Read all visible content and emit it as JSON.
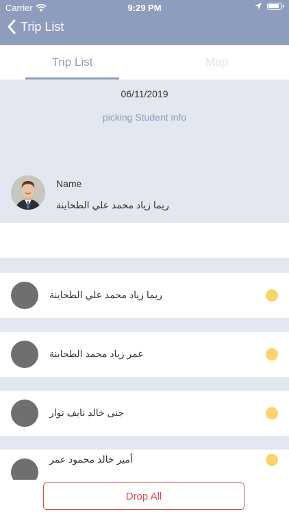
{
  "status_bar": {
    "carrier": "Carrier",
    "time": "9:29 PM"
  },
  "nav": {
    "back_label": "Trip List"
  },
  "tabs": {
    "items": [
      {
        "label": "Trip List",
        "active": true
      },
      {
        "label": "Map",
        "active": false
      }
    ]
  },
  "info": {
    "date": "06/11/2019",
    "subtitle": "picking Student info",
    "name_label": "Name",
    "name_value": "ريما زياد محمد علي الطحاينة"
  },
  "students": [
    {
      "name": "ريما زياد محمد علي الطحاينة"
    },
    {
      "name": "عمر زياد محمد الطحاينة"
    },
    {
      "name": "جنى خالد نايف نوار"
    },
    {
      "name": "أمير خالد محمود عمر"
    }
  ],
  "actions": {
    "drop_all_label": "Drop All"
  },
  "colors": {
    "header": "#8e9dbd",
    "panel": "#e3e7f0",
    "status_dot": "#fdd36e",
    "danger": "#d94a4a"
  }
}
